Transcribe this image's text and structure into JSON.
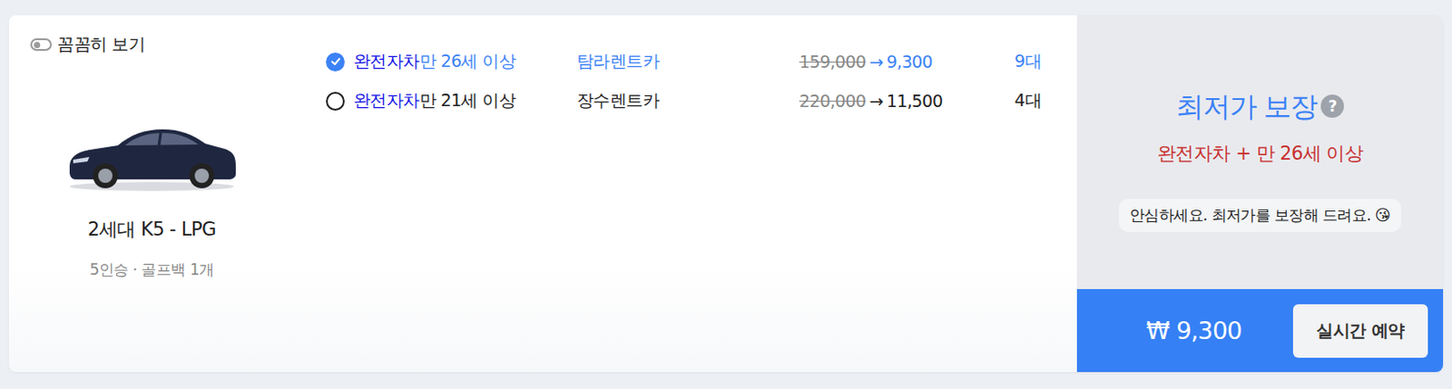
{
  "toggle": {
    "label": "꼼꼼히 보기",
    "on": false
  },
  "car": {
    "name": "2세대 K5 - LPG",
    "specs": "5인승 · 골프백 1개"
  },
  "options": [
    {
      "insurance": "완전자차",
      "age": "만 26세 이상",
      "company": "탐라렌트카",
      "original_price": "159,000",
      "arrow": "→",
      "price": "9,300",
      "count": "9대",
      "selected": true
    },
    {
      "insurance": "완전자차",
      "age": "만 21세 이상",
      "company": "장수렌트카",
      "original_price": "220,000",
      "arrow": "→",
      "price": "11,500",
      "count": "4대",
      "selected": false
    }
  ],
  "guarantee": {
    "title": "최저가 보장",
    "help": "?",
    "condition": "완전자차 + 만 26세 이상",
    "message": "안심하세요. 최저가를 보장해 드려요. 😘"
  },
  "footer": {
    "price": "₩ 9,300",
    "button": "실시간 예약"
  }
}
